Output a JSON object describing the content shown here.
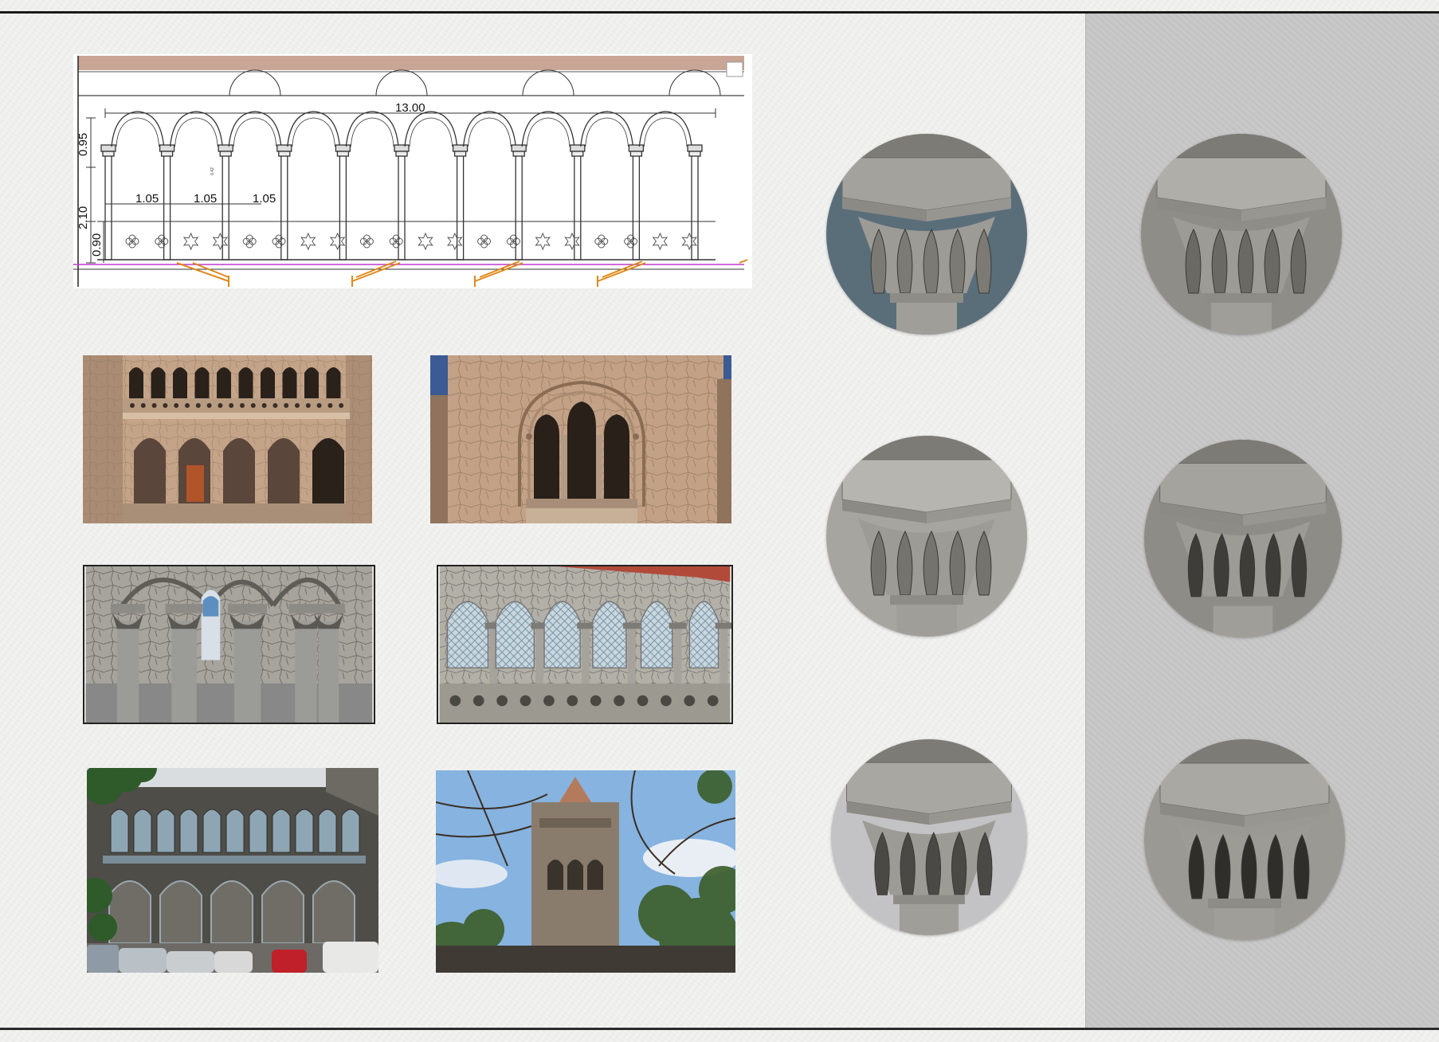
{
  "drawing": {
    "overall_width": "13.00",
    "bay_width_1": "1.05",
    "bay_width_2": "1.05",
    "bay_width_3": "1.05",
    "arch_height": "0.95",
    "column_height": "2.10",
    "parapet_height": "0.90",
    "small_note": "0.42"
  },
  "colors": {
    "paper": "#f2f2f0",
    "side_panel": "#c6c6c6",
    "stone": "#9a9a96",
    "render_sandstone": "#c9a98a",
    "roof_band": "#c9a596"
  },
  "images": [
    "render-arcade-elevation",
    "render-window-bay",
    "model-column-interior",
    "model-arcade-perspective",
    "photo-building-facade",
    "photo-tower"
  ],
  "capitals_left": [
    "capital-acanthus-render",
    "capital-mask-render",
    "capital-volute-render"
  ],
  "capitals_right": [
    "capital-leaf-model",
    "capital-corinthian-model",
    "capital-foliate-model"
  ]
}
